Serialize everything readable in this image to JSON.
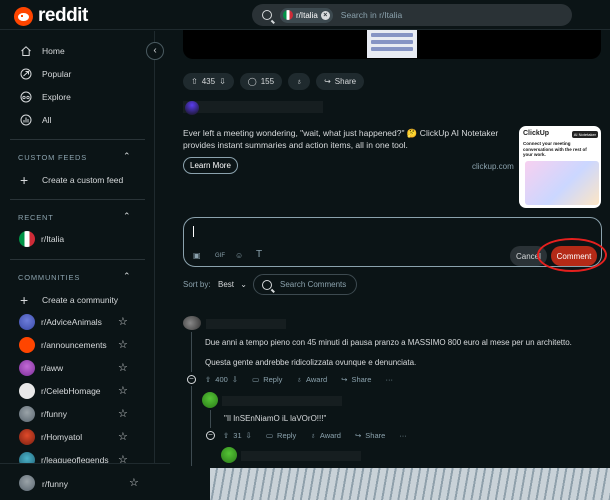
{
  "header": {
    "logo_text": "reddit",
    "search_chip": "r/Italia",
    "search_placeholder": "Search in r/Italia"
  },
  "sidebar": {
    "nav": [
      {
        "label": "Home",
        "icon": "home-icon"
      },
      {
        "label": "Popular",
        "icon": "popular-icon"
      },
      {
        "label": "Explore",
        "icon": "explore-icon"
      },
      {
        "label": "All",
        "icon": "all-icon"
      }
    ],
    "custom_feeds_title": "CUSTOM FEEDS",
    "create_custom_feed": "Create a custom feed",
    "recent_title": "RECENT",
    "recent_items": [
      "r/Italia"
    ],
    "communities_title": "COMMUNITIES",
    "create_community": "Create a community",
    "communities": [
      "r/AdviceAnimals",
      "r/announcements",
      "r/aww",
      "r/CelebHomage",
      "r/funny",
      "r/Homyatol",
      "r/leagueoflegends"
    ],
    "bottom_item": "r/funny"
  },
  "post_actions": {
    "votes": "435",
    "comments": "155",
    "share": "Share"
  },
  "ad": {
    "text": "Ever left a meeting wondering, \"wait, what just happened?\" 🤔 ClickUp AI Notetaker provides instant summaries and action items, all in one tool.",
    "cta": "Learn More",
    "domain": "clickup.com",
    "thumb_brand": "ClickUp",
    "thumb_badge": "AI Notetaker",
    "thumb_tagline": "Connect your meeting conversations with the rest of your work."
  },
  "composer": {
    "cancel": "Cancel",
    "submit": "Comment"
  },
  "sort": {
    "label": "Sort by:",
    "value": "Best",
    "search_comments": "Search Comments"
  },
  "comments": [
    {
      "text1": "Due anni a tempo pieno con 45 minuti di pausa pranzo a MASSIMO 800 euro al mese per un architetto.",
      "text2": "Questa gente andrebbe ridicolizzata ovunque e denunciata.",
      "votes": "400",
      "reply": "Reply",
      "award": "Award",
      "share": "Share"
    },
    {
      "text1": "\"Il InSEnNiamO iL laVOrO!!!\"",
      "votes": "31",
      "reply": "Reply",
      "award": "Award",
      "share": "Share"
    }
  ],
  "colors": {
    "background": "#0b1416",
    "accent": "#ff4500",
    "comment_button": "#b42a17",
    "highlight_ring": "#e5201e"
  }
}
